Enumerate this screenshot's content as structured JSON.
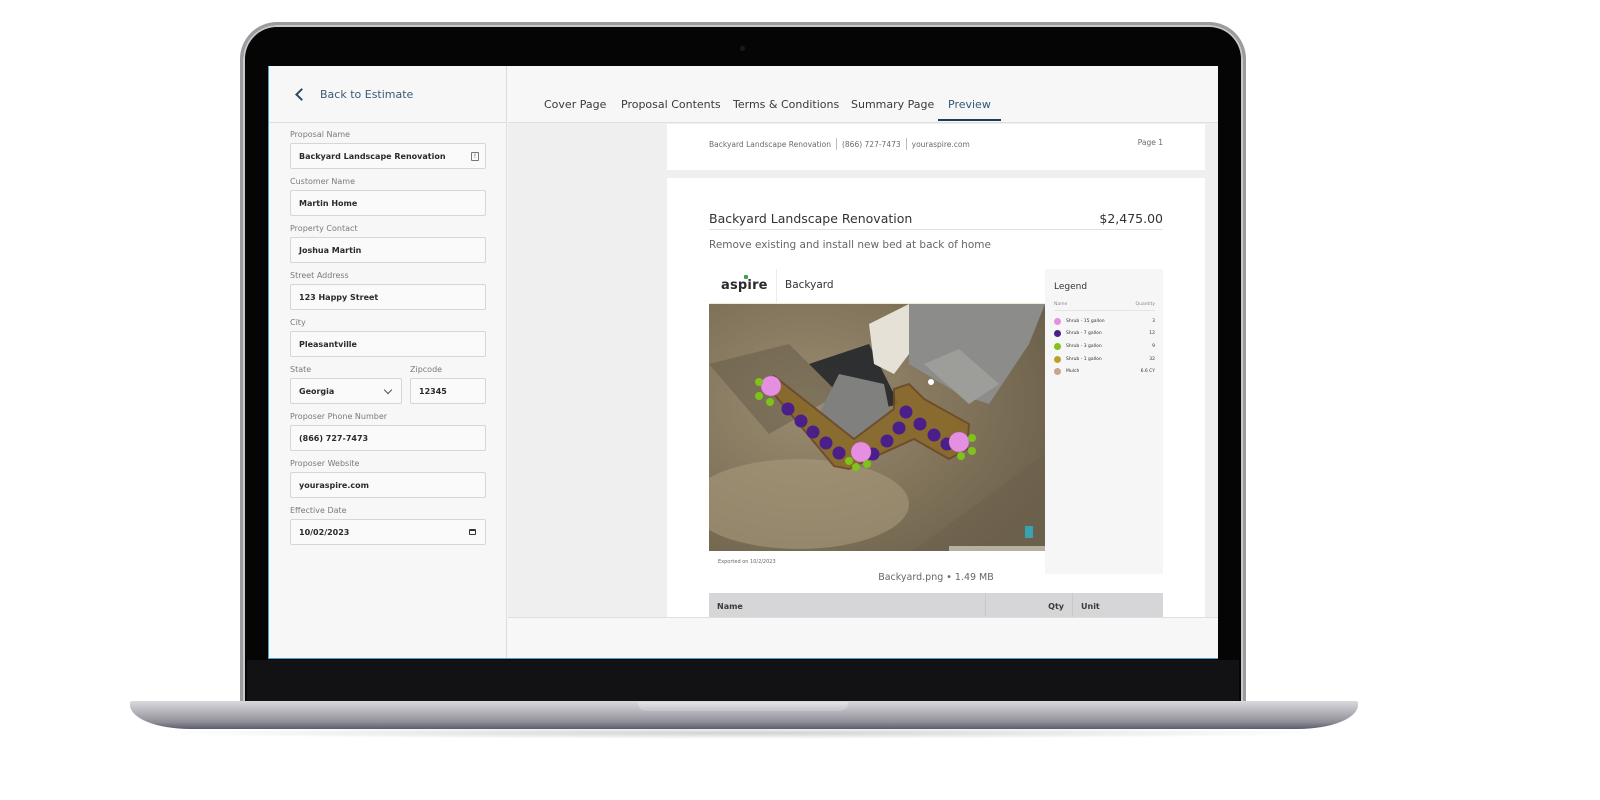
{
  "sidebar": {
    "back_label": "Back to Estimate",
    "fields": {
      "proposal_name": {
        "label": "Proposal Name",
        "value": "Backyard Landscape Renovation"
      },
      "customer_name": {
        "label": "Customer Name",
        "value": "Martin Home"
      },
      "property_contact": {
        "label": "Property Contact",
        "value": "Joshua Martin"
      },
      "street_address": {
        "label": "Street Address",
        "value": "123 Happy Street"
      },
      "city": {
        "label": "City",
        "value": "Pleasantville"
      },
      "state": {
        "label": "State",
        "value": "Georgia"
      },
      "zipcode": {
        "label": "Zipcode",
        "value": "12345"
      },
      "proposer_phone": {
        "label": "Proposer Phone Number",
        "value": "(866) 727-7473"
      },
      "proposer_website": {
        "label": "Proposer Website",
        "value": "youraspire.com"
      },
      "effective_date": {
        "label": "Effective Date",
        "value": "10/02/2023"
      }
    }
  },
  "tabs": [
    {
      "label": "Cover Page",
      "active": false
    },
    {
      "label": "Proposal Contents",
      "active": false
    },
    {
      "label": "Terms & Conditions",
      "active": false
    },
    {
      "label": "Summary Page",
      "active": false
    },
    {
      "label": "Preview",
      "active": true
    }
  ],
  "preview": {
    "header": {
      "proposal_name": "Backyard Landscape Renovation",
      "phone": "(866) 727-7473",
      "website": "youraspire.com",
      "page_label": "Page 1"
    },
    "section": {
      "title": "Backyard Landscape Renovation",
      "price": "$2,475.00",
      "description": "Remove existing and install new bed at back of home"
    },
    "map": {
      "logo_text": "aspire",
      "title": "Backyard",
      "exported_text": "Exported on 10/2/2023",
      "legend": {
        "title": "Legend",
        "col_name": "Name",
        "col_quantity": "Quantity",
        "items": [
          {
            "name": "Shrub - 15 gallon",
            "quantity": "3",
            "color": "#e58fe0"
          },
          {
            "name": "Shrub - 7 gallon",
            "quantity": "12",
            "color": "#4b1f8a"
          },
          {
            "name": "Shrub - 3 gallon",
            "quantity": "9",
            "color": "#7fc21b"
          },
          {
            "name": "Shrub - 1 gallon",
            "quantity": "32",
            "color": "#b9a22a"
          },
          {
            "name": "Mulch",
            "quantity": "6.6 CY",
            "color": "#c9a590"
          }
        ]
      }
    },
    "file_caption": "Backyard.png • 1.49 MB",
    "table": {
      "columns": [
        "Name",
        "Qty",
        "Unit"
      ]
    }
  },
  "colors": {
    "accent": "#1f3b55",
    "tab_active_text": "#2f5878"
  }
}
